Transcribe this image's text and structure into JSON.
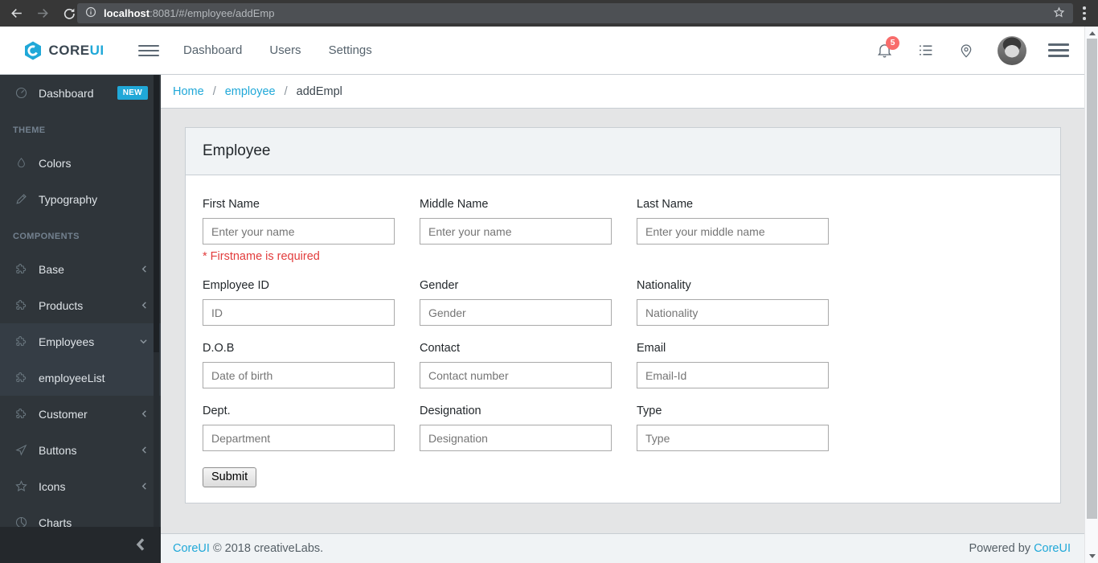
{
  "browser": {
    "url_host": "localhost",
    "url_rest": ":8081/#/employee/addEmp"
  },
  "header": {
    "brand_core": "CORE",
    "brand_ui": "UI",
    "nav": [
      {
        "label": "Dashboard"
      },
      {
        "label": "Users"
      },
      {
        "label": "Settings"
      }
    ],
    "notification_count": "5",
    "icons": [
      "bell-icon",
      "list-icon",
      "location-pin-icon",
      "user-avatar",
      "menu-icon"
    ]
  },
  "sidebar": {
    "items": [
      {
        "label": "Dashboard",
        "icon": "speedometer-icon",
        "badge": "NEW"
      },
      {
        "label": "THEME"
      },
      {
        "label": "Colors",
        "icon": "drop-icon"
      },
      {
        "label": "Typography",
        "icon": "pencil-icon"
      },
      {
        "label": "COMPONENTS"
      },
      {
        "label": "Base",
        "icon": "puzzle-icon",
        "chevron": "left"
      },
      {
        "label": "Products",
        "icon": "puzzle-icon",
        "chevron": "left"
      },
      {
        "label": "Employees",
        "icon": "puzzle-icon",
        "chevron": "down",
        "open": true
      },
      {
        "label": "employeeList",
        "icon": "puzzle-icon",
        "open": true
      },
      {
        "label": "Customer",
        "icon": "puzzle-icon",
        "chevron": "left"
      },
      {
        "label": "Buttons",
        "icon": "cursor-icon",
        "chevron": "left"
      },
      {
        "label": "Icons",
        "icon": "star-icon",
        "chevron": "left"
      },
      {
        "label": "Charts",
        "icon": "pie-chart-icon"
      }
    ]
  },
  "breadcrumb": {
    "separator": "/",
    "items": [
      "Home",
      "employee",
      "addEmpl"
    ]
  },
  "form": {
    "card_title": "Employee",
    "fields": [
      {
        "label": "First Name",
        "placeholder": "Enter your name",
        "error": "* Firstname is required"
      },
      {
        "label": "Middle Name",
        "placeholder": "Enter your name"
      },
      {
        "label": "Last Name",
        "placeholder": "Enter your middle name"
      },
      {
        "label": "Employee ID",
        "placeholder": "ID"
      },
      {
        "label": "Gender",
        "placeholder": "Gender"
      },
      {
        "label": "Nationality",
        "placeholder": "Nationality"
      },
      {
        "label": "D.O.B",
        "placeholder": "Date of birth"
      },
      {
        "label": "Contact",
        "placeholder": "Contact number"
      },
      {
        "label": "Email",
        "placeholder": "Email-Id"
      },
      {
        "label": "Dept.",
        "placeholder": "Department"
      },
      {
        "label": "Designation",
        "placeholder": "Designation"
      },
      {
        "label": "Type",
        "placeholder": "Type"
      }
    ],
    "submit_label": "Submit"
  },
  "footer": {
    "brand_link": "CoreUI",
    "copyright": "© 2018 creativeLabs.",
    "powered_text": "Powered by",
    "powered_link": "CoreUI"
  },
  "colors": {
    "accent": "#20a8d8",
    "sidebar_bg": "#2f353a",
    "badge_new_bg": "#20a8d8",
    "notification_badge_bg": "#f86c6b",
    "error_text": "#e23c3c",
    "content_bg": "#e4e5e6",
    "card_header_bg": "#f0f3f5",
    "border": "#c8ced3"
  }
}
